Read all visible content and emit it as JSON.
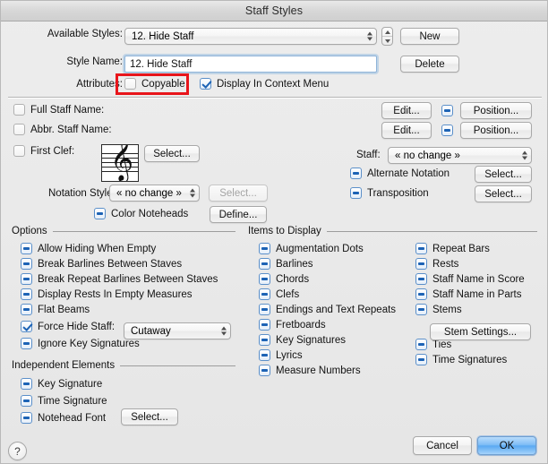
{
  "window": {
    "title": "Staff Styles"
  },
  "header": {
    "available_styles_label": "Available Styles:",
    "available_styles_value": "12.  Hide Staff",
    "style_name_label": "Style Name:",
    "style_name_value": "12.  Hide Staff",
    "attributes_label": "Attributes:",
    "copyable_label": "Copyable",
    "copyable_state": "off",
    "display_in_context_menu_label": "Display In Context Menu",
    "display_in_context_menu_state": "on",
    "new_button": "New",
    "delete_button": "Delete"
  },
  "names": {
    "full_staff_name_label": "Full Staff Name:",
    "full_staff_name_state": "off",
    "abbr_staff_name_label": "Abbr. Staff Name:",
    "abbr_staff_name_state": "off",
    "first_clef_label": "First Clef:",
    "first_clef_state": "off",
    "first_clef_select": "Select...",
    "notation_style_label": "Notation Style:",
    "notation_style_value": "« no change »",
    "notation_style_select": "Select...",
    "color_noteheads_label": "Color Noteheads",
    "color_noteheads_state": "mixed",
    "color_noteheads_define": "Define...",
    "edit_button_1": "Edit...",
    "position_button_1": "Position...",
    "position_check_1": "mixed",
    "edit_button_2": "Edit...",
    "position_button_2": "Position...",
    "position_check_2": "mixed",
    "staff_label": "Staff:",
    "staff_value": "« no change »",
    "alternate_notation_label": "Alternate Notation",
    "alternate_notation_state": "mixed",
    "alternate_notation_select": "Select...",
    "transposition_label": "Transposition",
    "transposition_state": "mixed",
    "transposition_select": "Select..."
  },
  "options": {
    "group_title": "Options",
    "items": [
      {
        "label": "Allow Hiding When Empty",
        "state": "mixed"
      },
      {
        "label": "Break Barlines Between Staves",
        "state": "mixed"
      },
      {
        "label": "Break Repeat Barlines Between Staves",
        "state": "mixed"
      },
      {
        "label": "Display Rests In Empty Measures",
        "state": "mixed"
      },
      {
        "label": "Flat Beams",
        "state": "mixed"
      },
      {
        "label": "Force Hide Staff:",
        "state": "on"
      },
      {
        "label": "Ignore Key Signatures",
        "state": "mixed"
      }
    ],
    "force_hide_staff_value": "Cutaway"
  },
  "independent_elements": {
    "group_title": "Independent Elements",
    "items": [
      {
        "label": "Key Signature",
        "state": "mixed"
      },
      {
        "label": "Time Signature",
        "state": "mixed"
      },
      {
        "label": "Notehead Font",
        "state": "mixed"
      }
    ],
    "notehead_font_select": "Select..."
  },
  "items_to_display": {
    "group_title": "Items to Display",
    "column1": [
      {
        "label": "Augmentation Dots",
        "state": "mixed"
      },
      {
        "label": "Barlines",
        "state": "mixed"
      },
      {
        "label": "Chords",
        "state": "mixed"
      },
      {
        "label": "Clefs",
        "state": "mixed"
      },
      {
        "label": "Endings and Text Repeats",
        "state": "mixed"
      },
      {
        "label": "Fretboards",
        "state": "mixed"
      },
      {
        "label": "Key Signatures",
        "state": "mixed"
      },
      {
        "label": "Lyrics",
        "state": "mixed"
      },
      {
        "label": "Measure Numbers",
        "state": "mixed"
      }
    ],
    "column2": [
      {
        "label": "Repeat Bars",
        "state": "mixed"
      },
      {
        "label": "Rests",
        "state": "mixed"
      },
      {
        "label": "Staff Name in Score",
        "state": "mixed"
      },
      {
        "label": "Staff Name in Parts",
        "state": "mixed"
      },
      {
        "label": "Stems",
        "state": "mixed"
      },
      {
        "label": "Ties",
        "state": "mixed"
      },
      {
        "label": "Time Signatures",
        "state": "mixed"
      }
    ],
    "stem_settings_button": "Stem Settings..."
  },
  "footer": {
    "help_glyph": "?",
    "cancel_button": "Cancel",
    "ok_button": "OK"
  },
  "annotation": {
    "highlight_target": "Copyable checkbox"
  },
  "colors": {
    "accent_blue": "#1d63b5",
    "annotation_red": "#e8151b",
    "window_bg": "#ececec"
  }
}
